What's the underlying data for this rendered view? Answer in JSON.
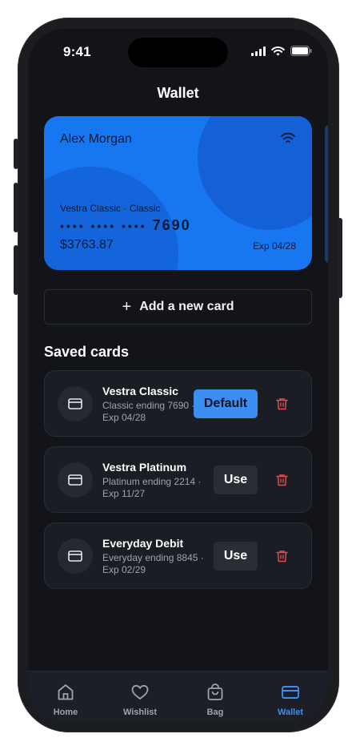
{
  "status": {
    "time": "9:41"
  },
  "header": {
    "title": "Wallet"
  },
  "card": {
    "holder": "Alex Morgan",
    "product": "Vestra Classic · Classic",
    "masked_dots": "•••• •••• ••••",
    "last4": "7690",
    "balance": "$3763.87",
    "expiry": "Exp 04/28",
    "color": "#1677f0"
  },
  "actions": {
    "add_card_label": "Add a new card"
  },
  "saved": {
    "title": "Saved cards",
    "items": [
      {
        "name": "Vestra Classic",
        "desc": "Classic ending 7690 · Exp 04/28",
        "action": "Default",
        "icon": "credit-card-icon"
      },
      {
        "name": "Vestra Platinum",
        "desc": "Platinum ending 2214 · Exp 11/27",
        "action": "Use",
        "icon": "credit-card-icon"
      },
      {
        "name": "Everyday Debit",
        "desc": "Everyday ending 8845 · Exp 02/29",
        "action": "Use",
        "icon": "credit-card-icon"
      }
    ]
  },
  "tabs": [
    {
      "label": "Home",
      "icon": "home-icon"
    },
    {
      "label": "Wishlist",
      "icon": "heart-icon"
    },
    {
      "label": "Bag",
      "icon": "bag-icon"
    },
    {
      "label": "Wallet",
      "icon": "wallet-card-icon",
      "active": true
    }
  ],
  "colors": {
    "accent": "#3b8ef2",
    "danger": "#e5484d",
    "background": "#12141a"
  }
}
